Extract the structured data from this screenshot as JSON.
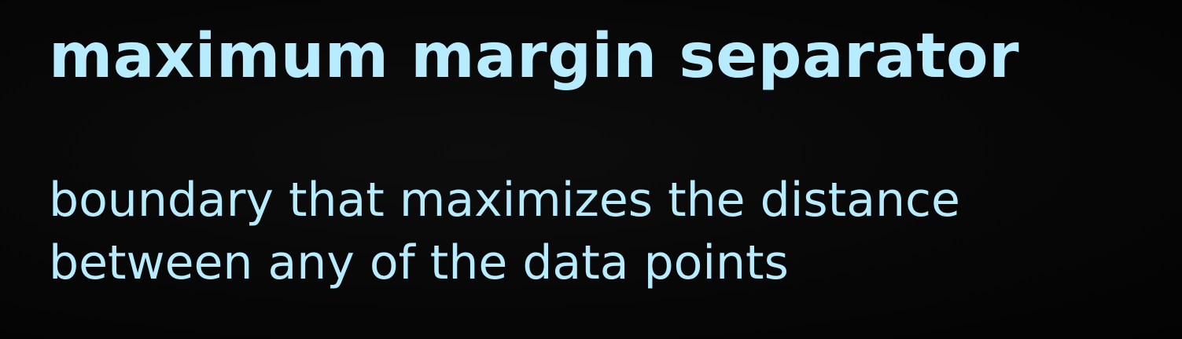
{
  "slide": {
    "title": "maximum margin separator",
    "body_lines": [
      "boundary that maximizes the distance",
      "between any of the data points"
    ]
  },
  "colors": {
    "background": "#060606",
    "text": "#b7ecff"
  }
}
